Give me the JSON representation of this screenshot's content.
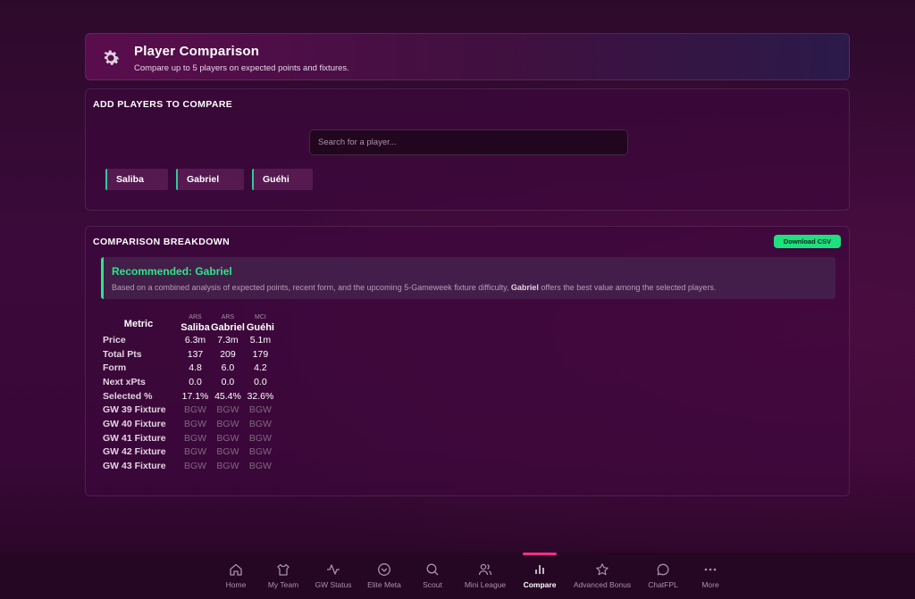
{
  "header": {
    "title": "Player Comparison",
    "subtitle": "Compare up to 5 players on expected points and fixtures.",
    "icon": "gear-icon"
  },
  "add_players": {
    "title": "ADD PLAYERS TO COMPARE",
    "search_placeholder": "Search for a player...",
    "chips": [
      "Saliba",
      "Gabriel",
      "Guéhi"
    ]
  },
  "breakdown": {
    "title": "COMPARISON BREAKDOWN",
    "download_label": "Download CSV",
    "recommendation": {
      "title": "Recommended: Gabriel",
      "text_before": "Based on a combined analysis of expected points, recent form, and the upcoming 5-Gameweek fixture difficulty, ",
      "player": "Gabriel",
      "text_after": " offers the best value among the selected players."
    },
    "table": {
      "metric_header": "Metric",
      "players": [
        {
          "team": "ARS",
          "name": "Saliba"
        },
        {
          "team": "ARS",
          "name": "Gabriel"
        },
        {
          "team": "MCI",
          "name": "Guéhi"
        }
      ],
      "rows": [
        {
          "label": "Price",
          "values": [
            "6.3m",
            "7.3m",
            "5.1m"
          ],
          "kind": "val"
        },
        {
          "label": "Total Pts",
          "values": [
            "137",
            "209",
            "179"
          ],
          "kind": "val"
        },
        {
          "label": "Form",
          "values": [
            "4.8",
            "6.0",
            "4.2"
          ],
          "kind": "val"
        },
        {
          "label": "Next xPts",
          "values": [
            "0.0",
            "0.0",
            "0.0"
          ],
          "kind": "val"
        },
        {
          "label": "Selected %",
          "values": [
            "17.1%",
            "45.4%",
            "32.6%"
          ],
          "kind": "val"
        },
        {
          "label": "GW 39 Fixture",
          "values": [
            "BGW",
            "BGW",
            "BGW"
          ],
          "kind": "fx"
        },
        {
          "label": "GW 40 Fixture",
          "values": [
            "BGW",
            "BGW",
            "BGW"
          ],
          "kind": "fx"
        },
        {
          "label": "GW 41 Fixture",
          "values": [
            "BGW",
            "BGW",
            "BGW"
          ],
          "kind": "fx"
        },
        {
          "label": "GW 42 Fixture",
          "values": [
            "BGW",
            "BGW",
            "BGW"
          ],
          "kind": "fx"
        },
        {
          "label": "GW 43 Fixture",
          "values": [
            "BGW",
            "BGW",
            "BGW"
          ],
          "kind": "fx"
        }
      ]
    }
  },
  "nav": {
    "items": [
      {
        "label": "Home",
        "icon": "home-icon"
      },
      {
        "label": "My Team",
        "icon": "shirt-icon"
      },
      {
        "label": "GW Status",
        "icon": "activity-icon"
      },
      {
        "label": "Elite Meta",
        "icon": "chevron-circle-icon"
      },
      {
        "label": "Scout",
        "icon": "search-icon"
      },
      {
        "label": "Mini League",
        "icon": "users-icon"
      },
      {
        "label": "Compare",
        "icon": "bar-chart-icon"
      },
      {
        "label": "Advanced Bonus",
        "icon": "star-icon"
      },
      {
        "label": "ChatFPL",
        "icon": "chat-icon"
      },
      {
        "label": "More",
        "icon": "more-icon"
      }
    ],
    "active": "Compare"
  },
  "colors": {
    "accent_green": "#2ee58a",
    "active_pink": "#ff2e8a",
    "chip_border": "#35c89a"
  }
}
